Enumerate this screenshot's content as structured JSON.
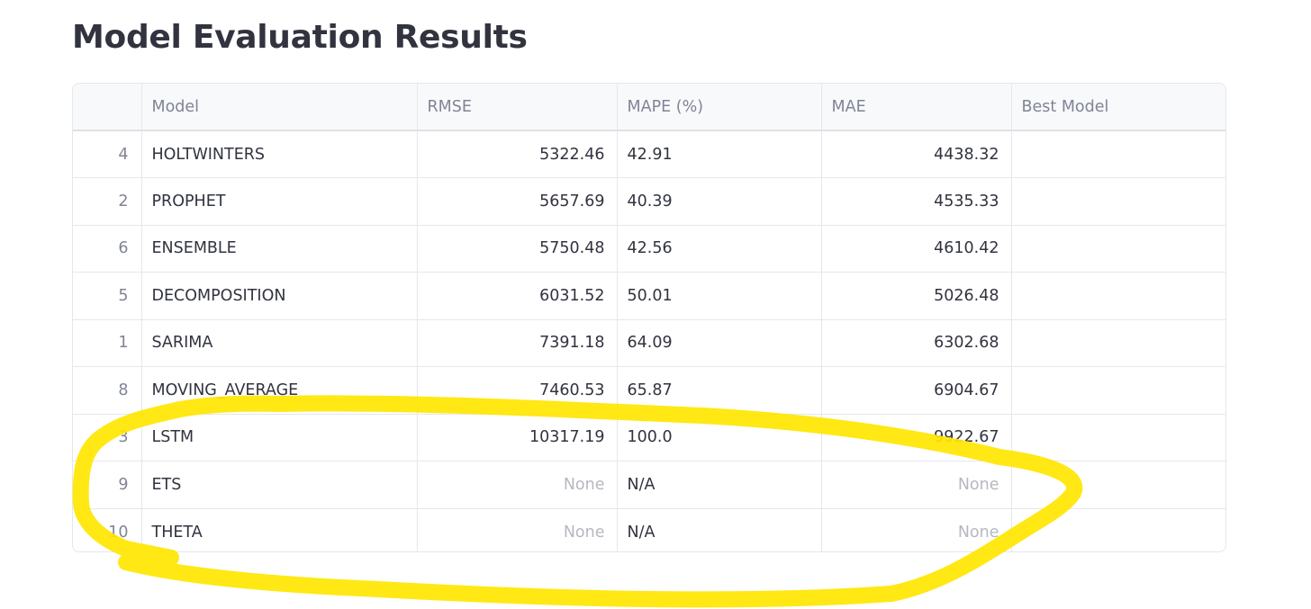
{
  "page": {
    "title": "Model Evaluation Results"
  },
  "table": {
    "columns": [
      "",
      "Model",
      "RMSE",
      "MAPE (%)",
      "MAE",
      "Best Model"
    ],
    "rows": [
      {
        "index": "4",
        "model": "HOLTWINTERS",
        "rmse": "5322.46",
        "mape": "42.91",
        "mae": "4438.32",
        "best": ""
      },
      {
        "index": "2",
        "model": "PROPHET",
        "rmse": "5657.69",
        "mape": "40.39",
        "mae": "4535.33",
        "best": ""
      },
      {
        "index": "6",
        "model": "ENSEMBLE",
        "rmse": "5750.48",
        "mape": "42.56",
        "mae": "4610.42",
        "best": ""
      },
      {
        "index": "5",
        "model": "DECOMPOSITION",
        "rmse": "6031.52",
        "mape": "50.01",
        "mae": "5026.48",
        "best": ""
      },
      {
        "index": "1",
        "model": "SARIMA",
        "rmse": "7391.18",
        "mape": "64.09",
        "mae": "6302.68",
        "best": ""
      },
      {
        "index": "8",
        "model": "MOVING_AVERAGE",
        "rmse": "7460.53",
        "mape": "65.87",
        "mae": "6904.67",
        "best": ""
      },
      {
        "index": "3",
        "model": "LSTM",
        "rmse": "10317.19",
        "mape": "100.0",
        "mae": "9922.67",
        "best": ""
      },
      {
        "index": "9",
        "model": "ETS",
        "rmse": "None",
        "mape": "N/A",
        "mae": "None",
        "best": ""
      },
      {
        "index": "10",
        "model": "THETA",
        "rmse": "None",
        "mape": "N/A",
        "mae": "None",
        "best": ""
      }
    ]
  },
  "annotation": {
    "color": "#ffe600"
  }
}
